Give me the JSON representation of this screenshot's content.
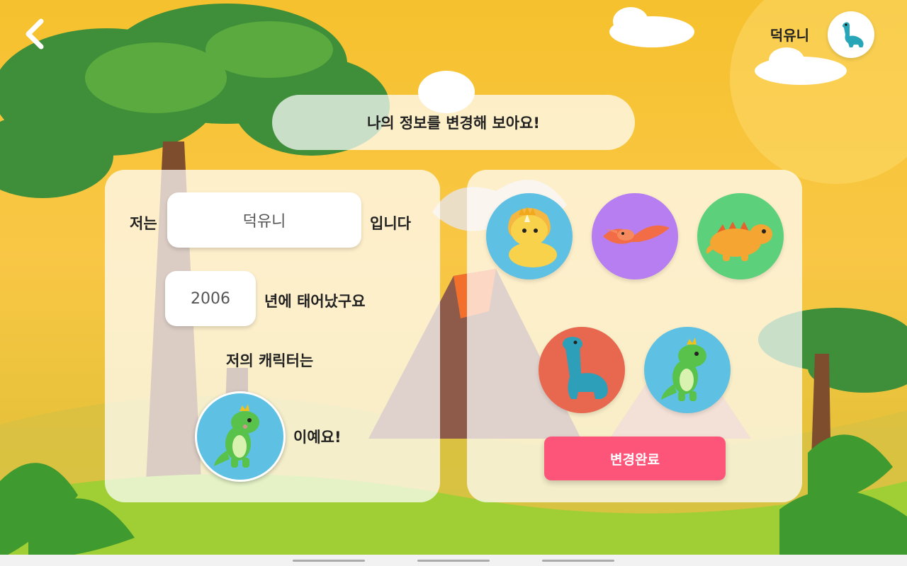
{
  "header": {
    "back_icon": "chevron-left-icon",
    "user_name": "덕유니",
    "avatar_icon": "dinosaur-avatar-icon"
  },
  "title": "나의 정보를 변경해 보아요!",
  "profile": {
    "name_prefix": "저는",
    "name_value": "덕유니",
    "name_suffix": "입니다",
    "year_value": "2006",
    "year_suffix": "년에 태어났구요",
    "character_prefix": "저의 캐릭터는",
    "character_suffix": "이예요!"
  },
  "characters": [
    {
      "name": "triceratops-character",
      "bg": "#5ec0e3"
    },
    {
      "name": "pterodactyl-character",
      "bg": "#b77ef2"
    },
    {
      "name": "stegosaurus-character",
      "bg": "#5cd07a"
    },
    {
      "name": "brachiosaurus-character",
      "bg": "#e7674f"
    },
    {
      "name": "crowned-trex-character",
      "bg": "#5ec0e3"
    }
  ],
  "selected_character": "crowned-trex-character",
  "done_button": {
    "label": "변경완료",
    "color": "#fd5479"
  },
  "colors": {
    "sky": "#f6c12e",
    "panel": "rgba(255,255,255,0.72)"
  }
}
